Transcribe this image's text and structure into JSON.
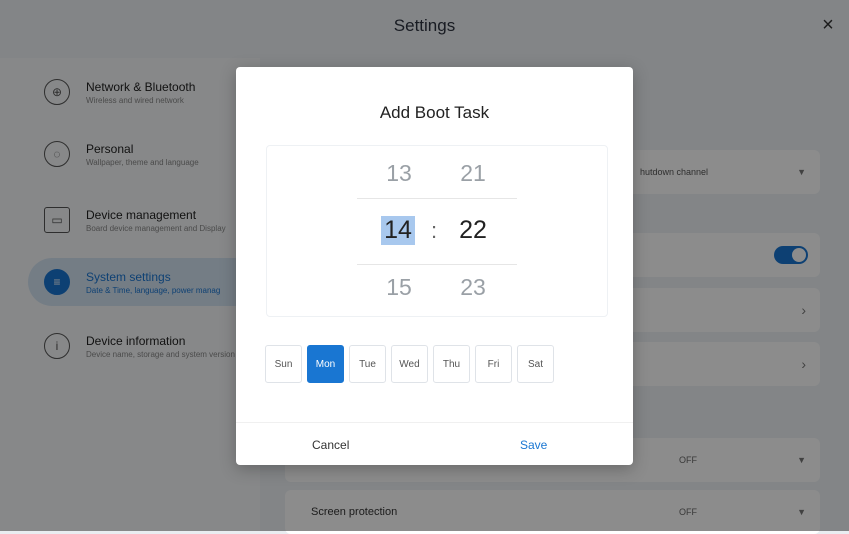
{
  "window": {
    "title": "Settings",
    "close_icon": "×"
  },
  "sidebar": {
    "items": [
      {
        "label": "Network & Bluetooth",
        "sub": "Wireless and wired network",
        "icon": "globe-icon",
        "glyph": "⊕",
        "active": false
      },
      {
        "label": "Personal",
        "sub": "Wallpaper, theme and language",
        "icon": "palette-icon",
        "glyph": "◌",
        "active": false
      },
      {
        "label": "Device management",
        "sub": "Board device management and Display",
        "icon": "device-icon",
        "glyph": "▭",
        "active": false
      },
      {
        "label": "System settings",
        "sub": "Date & Time, language, power manag",
        "icon": "sliders-icon",
        "glyph": "≡",
        "active": true
      },
      {
        "label": "Device information",
        "sub": "Device name, storage and system version",
        "icon": "info-icon",
        "glyph": "i",
        "active": false
      }
    ]
  },
  "content": {
    "channel_select": "hutdown channel",
    "row3_select": "OFF",
    "screen_protection_label": "Screen protection",
    "screen_protection_value": "OFF"
  },
  "dialog": {
    "title": "Add Boot Task",
    "hours": [
      "13",
      "14",
      "15"
    ],
    "minutes": [
      "21",
      "22",
      "23"
    ],
    "separator": ":",
    "days": [
      "Sun",
      "Mon",
      "Tue",
      "Wed",
      "Thu",
      "Fri",
      "Sat"
    ],
    "selected_day": "Mon",
    "cancel_label": "Cancel",
    "save_label": "Save"
  },
  "colors": {
    "accent": "#1976d2"
  }
}
